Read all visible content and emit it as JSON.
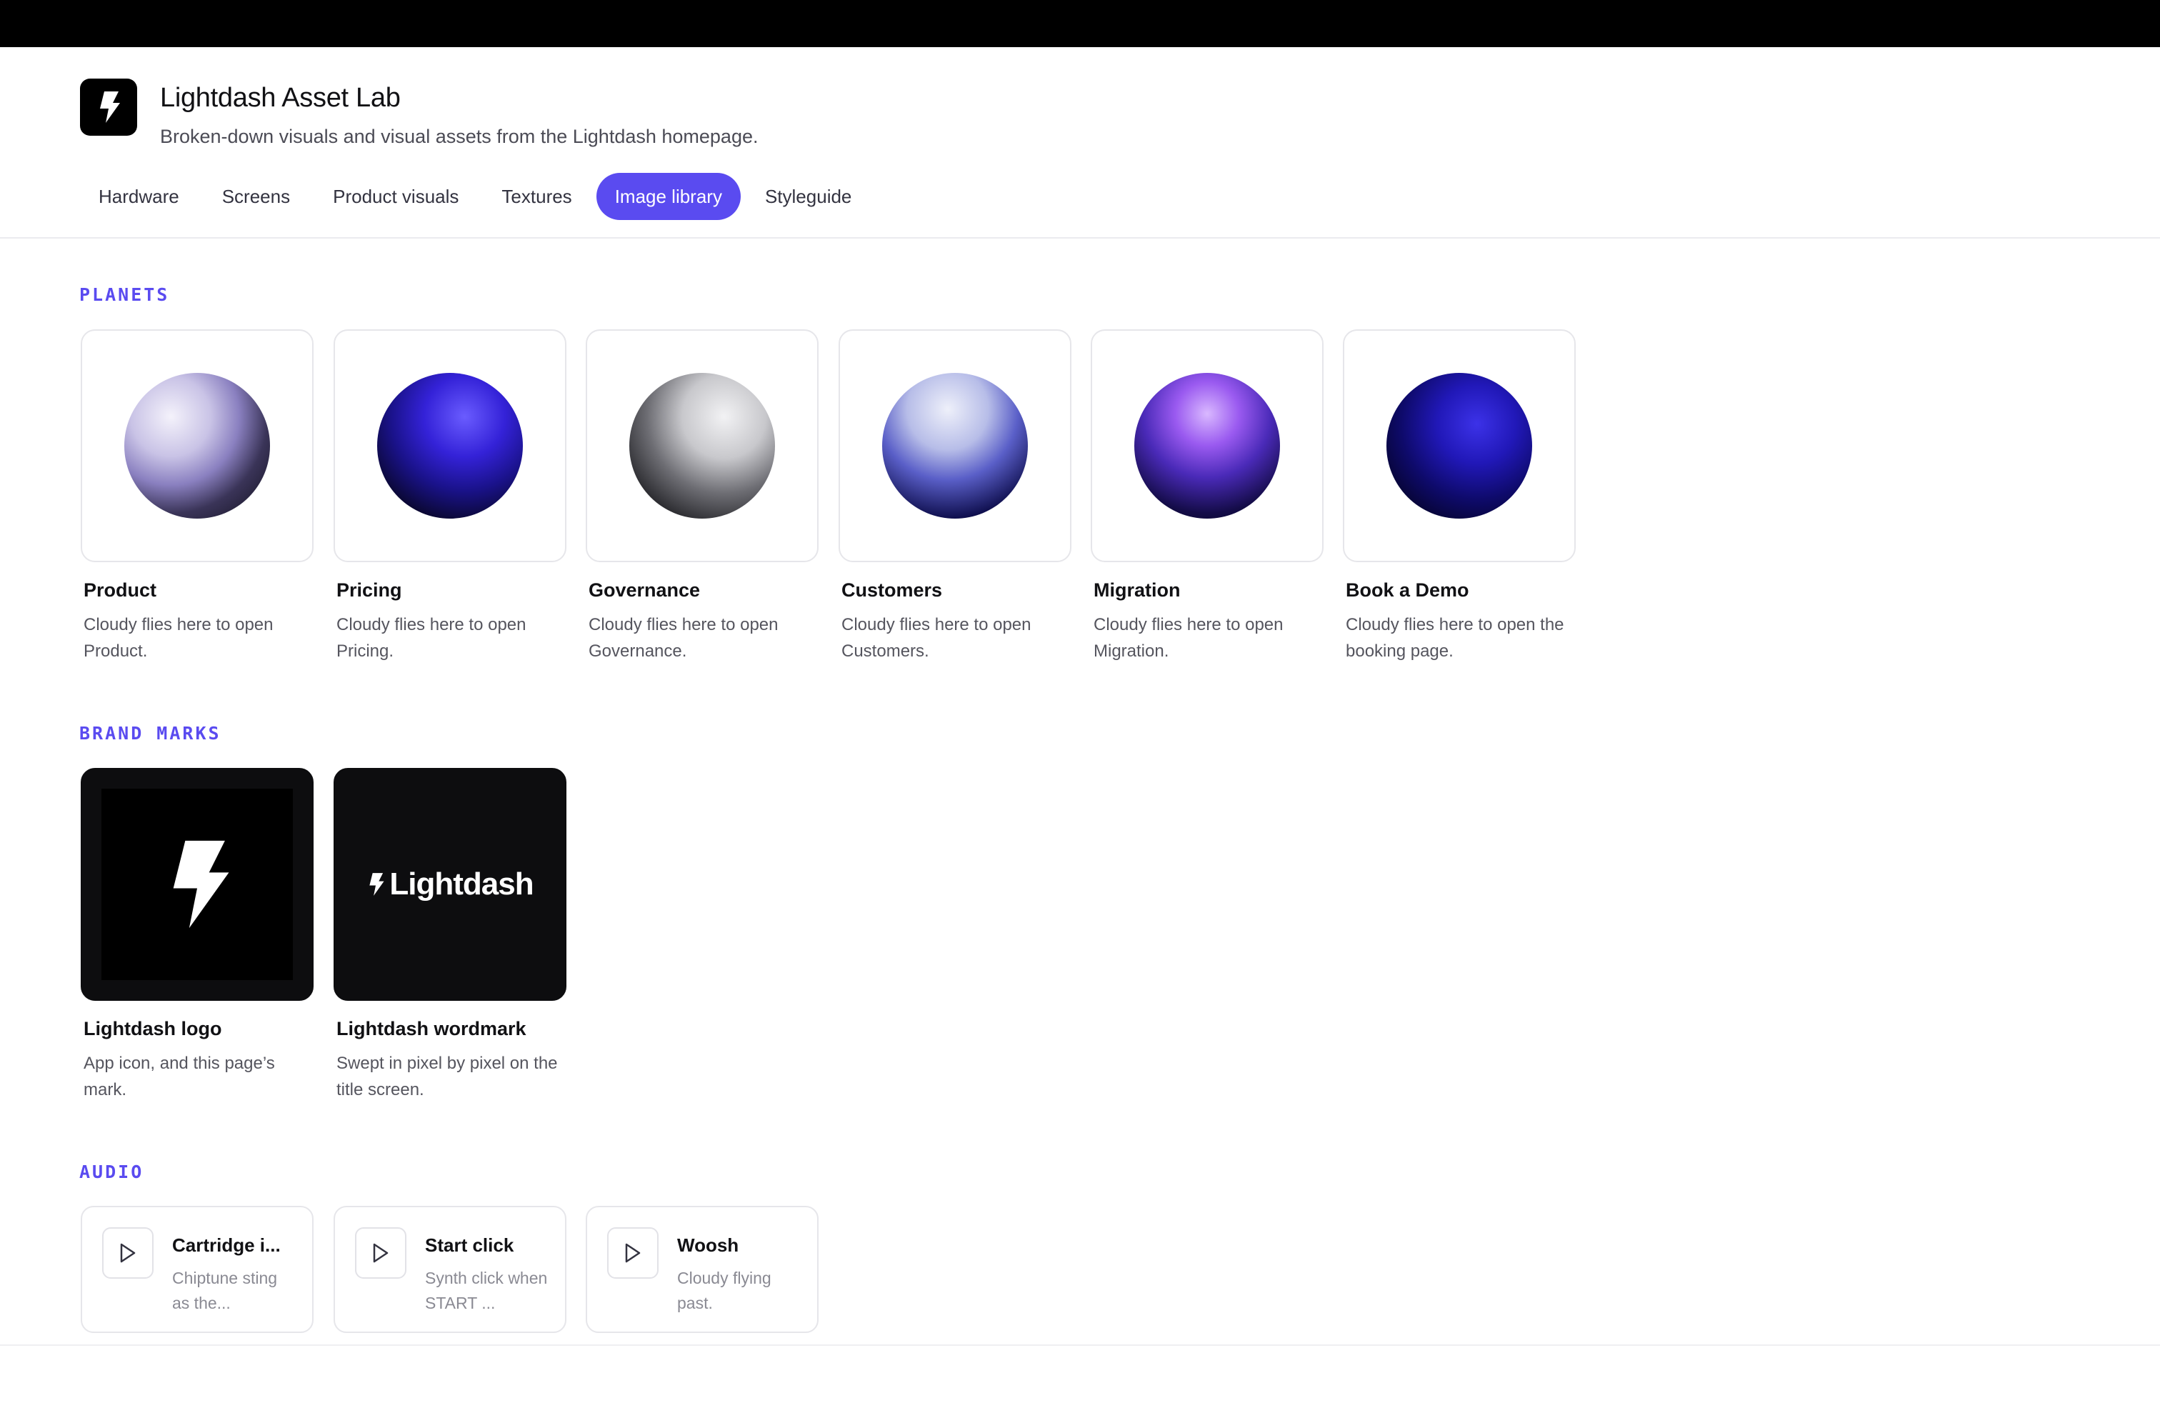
{
  "app": {
    "title": "Lightdash Asset Lab",
    "subtitle": "Broken-down visuals and visual assets from the Lightdash homepage.",
    "icon": "lightning-bolt-icon"
  },
  "tabs": [
    {
      "label": "Hardware",
      "active": false
    },
    {
      "label": "Screens",
      "active": false
    },
    {
      "label": "Product visuals",
      "active": false
    },
    {
      "label": "Textures",
      "active": false
    },
    {
      "label": "Image library",
      "active": true
    },
    {
      "label": "Styleguide",
      "active": false
    }
  ],
  "sections": {
    "planets": {
      "title": "PLANETS",
      "items": [
        {
          "title": "Product",
          "desc": "Cloudy flies here to open Product."
        },
        {
          "title": "Pricing",
          "desc": "Cloudy flies here to open Pricing."
        },
        {
          "title": "Governance",
          "desc": "Cloudy flies here to open Governance."
        },
        {
          "title": "Customers",
          "desc": "Cloudy flies here to open Customers."
        },
        {
          "title": "Migration",
          "desc": "Cloudy flies here to open Migration."
        },
        {
          "title": "Book a Demo",
          "desc": "Cloudy flies here to open the booking page."
        }
      ]
    },
    "brand": {
      "title": "BRAND MARKS",
      "items": [
        {
          "title": "Lightdash logo",
          "desc": "App icon, and this page’s mark."
        },
        {
          "title": "Lightdash wordmark",
          "desc": "Swept in pixel by pixel on the title screen.",
          "wordmark": "Lightdash"
        }
      ]
    },
    "audio": {
      "title": "AUDIO",
      "items": [
        {
          "title": "Cartridge i...",
          "desc": "Chiptune sting as the..."
        },
        {
          "title": "Start click",
          "desc": "Synth click when START ..."
        },
        {
          "title": "Woosh",
          "desc": "Cloudy flying past."
        }
      ]
    }
  },
  "colors": {
    "accent": "#5a4bf0",
    "topbar": "#000000",
    "tile_border": "#e6e6ea"
  }
}
